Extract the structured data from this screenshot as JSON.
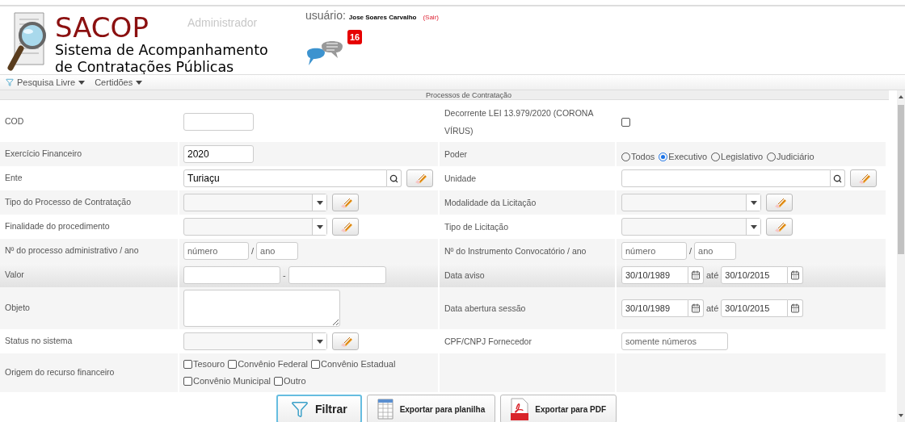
{
  "header": {
    "title": "SACOP",
    "subtitle": [
      "Sistema de Acompanhamento",
      "de Contratações Públicas"
    ],
    "role": "Administrador",
    "user_label": "usuário:",
    "user_name": "Jose Soares Carvalho",
    "logout": "(Sair)",
    "message_count": "16"
  },
  "menu": [
    {
      "label": "Pesquisa Livre",
      "kind": "filter"
    },
    {
      "label": "Certidões",
      "kind": "plain"
    }
  ],
  "section_title": "Processos de Contratação",
  "rows": [
    {
      "hovered": false,
      "left": {
        "label": "COD",
        "kind": "text"
      },
      "right": {
        "label": "Decorrente LEI 13.979/2020 (CORONA VÍRUS)",
        "kind": "checkbox",
        "checked": false
      }
    },
    {
      "hovered": false,
      "left": {
        "label": "Exercício Financeiro",
        "kind": "text",
        "value": "2020"
      },
      "right": {
        "label": "Poder",
        "kind": "radios",
        "options": [
          {
            "label": "Todos",
            "selected": false
          },
          {
            "label": "Executivo",
            "selected": true
          },
          {
            "label": "Legislativo",
            "selected": false
          },
          {
            "label": "Judiciário",
            "selected": false
          }
        ]
      }
    },
    {
      "hovered": false,
      "left": {
        "label": "Ente",
        "kind": "lookup",
        "value": "Turiaçu"
      },
      "right": {
        "label": "Unidade",
        "kind": "lookup"
      }
    },
    {
      "hovered": false,
      "left": {
        "label": "Tipo do Processo de Contratação",
        "kind": "select"
      },
      "right": {
        "label": "Modalidade da Licitação",
        "kind": "select"
      }
    },
    {
      "hovered": false,
      "left": {
        "label": "Finalidade do procedimento",
        "kind": "select"
      },
      "right": {
        "label": "Tipo de Licitação",
        "kind": "select"
      }
    },
    {
      "hovered": false,
      "left": {
        "label": "Nº do processo administrativo / ano",
        "kind": "numyear",
        "placeholders": [
          "número",
          "ano"
        ],
        "separator": "/"
      },
      "right": {
        "label": "Nº do Instrumento Convocatório / ano",
        "kind": "numyear",
        "placeholders": [
          "número",
          "ano"
        ],
        "separator": "/"
      }
    },
    {
      "hovered": true,
      "left": {
        "label": "Valor",
        "kind": "range",
        "separator": "-"
      },
      "right": {
        "label": "Data aviso",
        "kind": "dates",
        "from": "30/10/1989",
        "to": "30/10/2015",
        "separator": "até"
      }
    },
    {
      "hovered": false,
      "left": {
        "label": "Objeto",
        "kind": "textarea"
      },
      "right": {
        "label": "Data abertura sessão",
        "kind": "dates",
        "from": "30/10/1989",
        "to": "30/10/2015",
        "separator": "até"
      }
    },
    {
      "hovered": false,
      "left": {
        "label": "Status no sistema",
        "kind": "select"
      },
      "right": {
        "label": "CPF/CNPJ Fornecedor",
        "kind": "text",
        "placeholder": "somente números"
      }
    },
    {
      "hovered": false,
      "left": {
        "label": "Origem do recurso financeiro",
        "kind": "checkboxes",
        "options": [
          {
            "label": "Tesouro",
            "checked": false
          },
          {
            "label": "Convênio Federal",
            "checked": false
          },
          {
            "label": "Convênio Estadual",
            "checked": false
          },
          {
            "label": "Convênio Municipal",
            "checked": false
          },
          {
            "label": "Outro",
            "checked": false
          }
        ]
      },
      "right": {
        "kind": "empty"
      }
    }
  ],
  "buttons": [
    {
      "label": "Filtrar",
      "kind": "filter"
    },
    {
      "label": "Exportar para planilha",
      "kind": "sheet"
    },
    {
      "label": "Exportar para PDF",
      "kind": "pdf"
    }
  ]
}
